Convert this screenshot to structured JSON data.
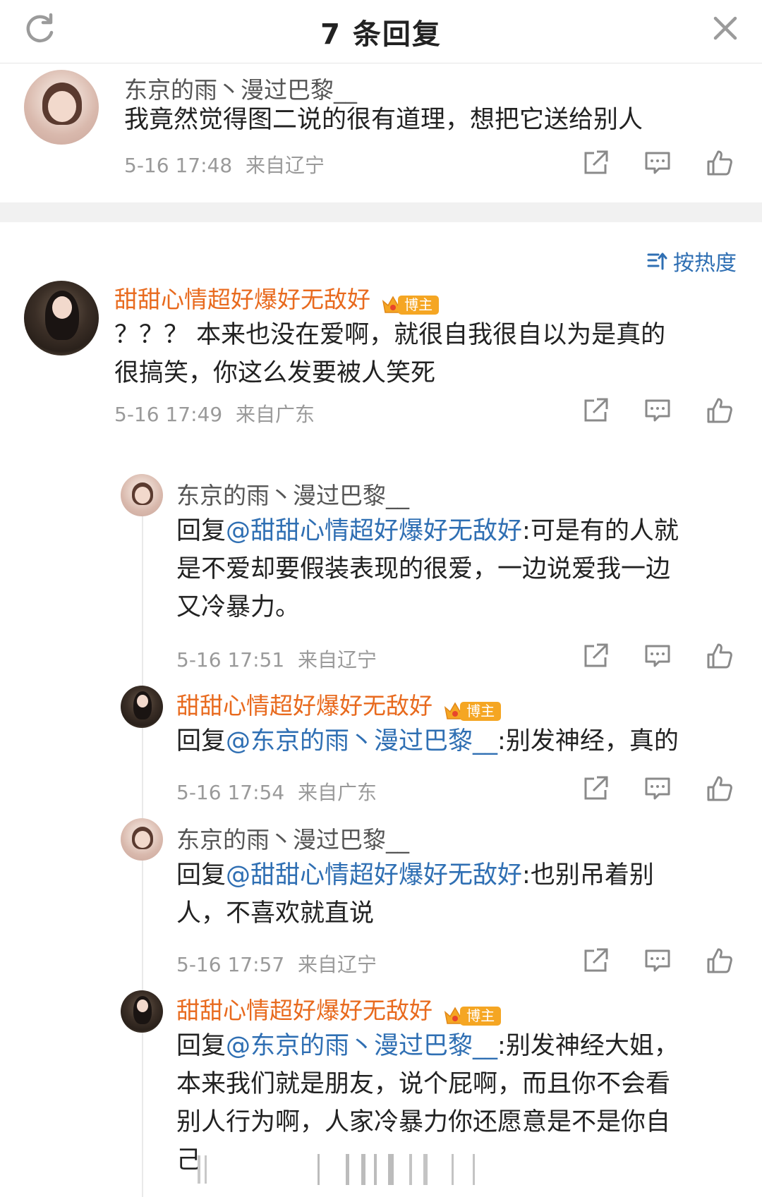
{
  "header": {
    "title": "7 条回复",
    "refresh_icon": "refresh-icon",
    "close_icon": "close-icon"
  },
  "root_comment": {
    "author": "东京的雨丶漫过巴黎__",
    "text": "我竟然觉得图二说的很有道理，想把它送给别人",
    "time": "5-16 17:48",
    "location": "来自辽宁"
  },
  "sort": {
    "label": "按热度",
    "icon": "sort-icon"
  },
  "comments": [
    {
      "author": "甜甜心情超好爆好无敌好",
      "badge": "博主",
      "text_line1": "？？？ 本来也没在爱啊，就很自我很自以为是真的",
      "text_line2": "很搞笑，你这么发要被人笑死",
      "time": "5-16 17:49",
      "location": "来自广东"
    }
  ],
  "replies": [
    {
      "author": "东京的雨丶漫过巴黎__",
      "prefix": "回复",
      "mention": "@甜甜心情超好爆好无敌好",
      "line1_rest": ":可是有的人就",
      "line2": "是不爱却要假装表现的很爱，一边说爱我一边",
      "line3": "又冷暴力。",
      "time": "5-16 17:51",
      "location": "来自辽宁"
    },
    {
      "author": "甜甜心情超好爆好无敌好",
      "badge": "博主",
      "prefix": "回复",
      "mention": "@东京的雨丶漫过巴黎__",
      "line1_rest": ":别发神经，真的",
      "time": "5-16 17:54",
      "location": "来自广东"
    },
    {
      "author": "东京的雨丶漫过巴黎__",
      "prefix": "回复",
      "mention": "@甜甜心情超好爆好无敌好",
      "line1_rest": ":也别吊着别",
      "line2": "人，不喜欢就直说",
      "time": "5-16 17:57",
      "location": "来自辽宁"
    },
    {
      "author": "甜甜心情超好爆好无敌好",
      "badge": "博主",
      "prefix": "回复",
      "mention": "@东京的雨丶漫过巴黎__",
      "line1_rest": ":别发神经大姐，",
      "line2": "本来我们就是朋友，说个屁啊，而且你不会看",
      "line3": "别人行为啊，人家冷暴力你还愿意是不是你自",
      "line4": "己"
    }
  ],
  "colors": {
    "accent_blue": "#2f6fb3",
    "author_orange": "#e86a1e",
    "badge_orange": "#f5a623",
    "meta_gray": "#9a9a9a"
  }
}
